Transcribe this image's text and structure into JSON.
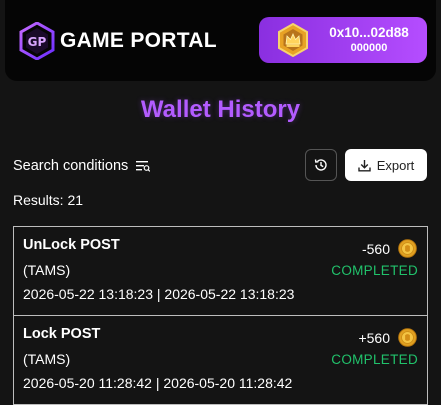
{
  "header": {
    "logo_text": "GAME PORTAL",
    "wallet": {
      "address": "0x10...02d88",
      "balance": "000000"
    }
  },
  "page": {
    "title": "Wallet History"
  },
  "toolbar": {
    "search_label": "Search conditions",
    "export_label": "Export"
  },
  "results": {
    "label": "Results: 21"
  },
  "transactions": [
    {
      "type": "UnLock POST",
      "token": "(TAMS)",
      "dates": "2026-05-22 13:18:23 | 2026-05-22 13:18:23",
      "amount": "-560",
      "status": "COMPLETED"
    },
    {
      "type": "Lock POST",
      "token": "(TAMS)",
      "dates": "2026-05-20 11:28:42 | 2026-05-20 11:28:42",
      "amount": "+560",
      "status": "COMPLETED"
    }
  ],
  "colors": {
    "accent": "#9b3ff0",
    "status_completed": "#21c26b",
    "background": "#141414"
  },
  "icons": {
    "logo": "gp-logo-icon",
    "wallet_badge": "crown-badge-icon",
    "filter": "filter-list-icon",
    "history": "history-icon",
    "export": "download-icon",
    "coin": "coin-icon"
  }
}
